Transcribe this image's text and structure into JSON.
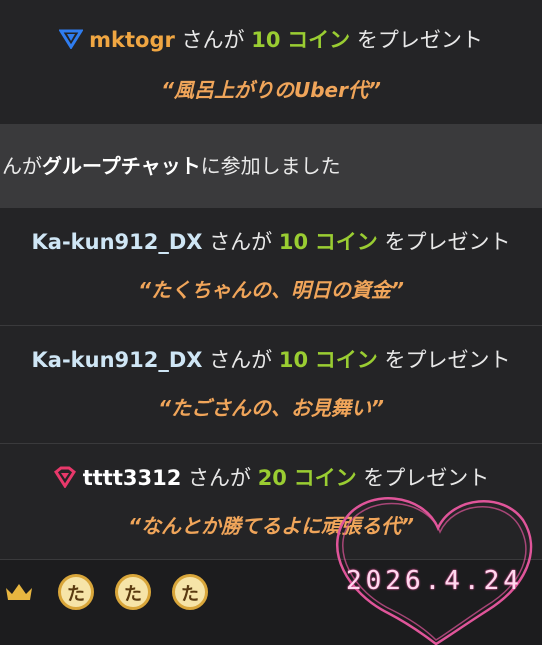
{
  "gifts": [
    {
      "user": "mktogr",
      "suffix": "さんが",
      "amount": "10",
      "unit": "コイン",
      "action": "をプレゼント",
      "message": "“風呂上がりのUber代”",
      "badge": "triangle-badge-icon"
    },
    {
      "user": "Ka-kun912_DX",
      "suffix": "さんが",
      "amount": "10",
      "unit": "コイン",
      "action": "をプレゼント",
      "message": "“たくちゃんの、明日の資金”"
    },
    {
      "user": "Ka-kun912_DX",
      "suffix": "さんが",
      "amount": "10",
      "unit": "コイン",
      "action": "をプレゼント",
      "message": "“たごさんの、お見舞い”"
    },
    {
      "user": "tttt3312",
      "suffix": "さんが",
      "amount": "20",
      "unit": "コイン",
      "action": "をプレゼント",
      "message": "“なんとか勝てるよに頑張る代”",
      "badge": "diamond-badge-icon"
    }
  ],
  "system": {
    "prefix": "んが",
    "bold": "グループチャット",
    "suffix": "に参加しました"
  },
  "bottom": {
    "date": "2026.4.24",
    "coin_glyph": "た"
  },
  "colors": {
    "username_orange": "#f0a642",
    "coin_green": "#9acd32",
    "message_orange": "#f0a55a",
    "heart_pink": "#e0559a"
  }
}
